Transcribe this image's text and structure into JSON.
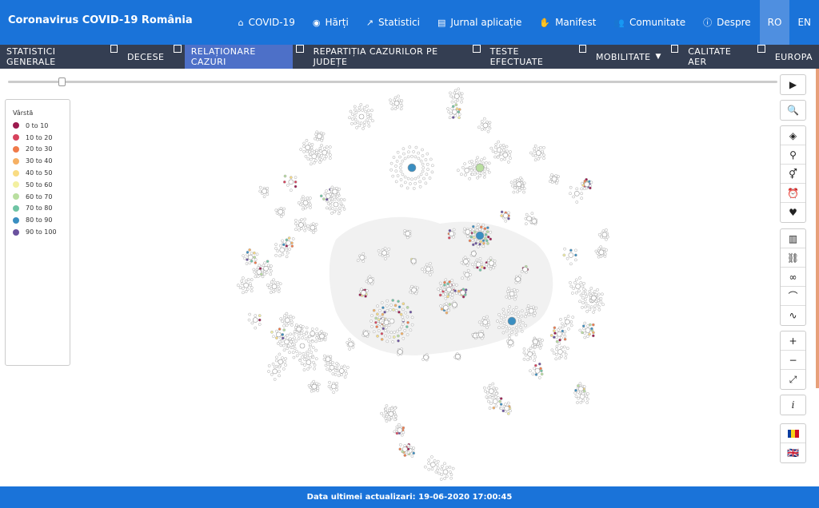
{
  "header": {
    "title": "Coronavirus COVID-19 România",
    "nav": [
      {
        "label": "COVID-19",
        "icon": "home-icon",
        "glyph": "⌂"
      },
      {
        "label": "Hărți",
        "icon": "compass-icon",
        "glyph": "◉"
      },
      {
        "label": "Statistici",
        "icon": "chart-line-icon",
        "glyph": "↗"
      },
      {
        "label": "Jurnal aplicație",
        "icon": "document-icon",
        "glyph": "▤"
      },
      {
        "label": "Manifest",
        "icon": "hand-icon",
        "glyph": "✋"
      },
      {
        "label": "Comunitate",
        "icon": "users-icon",
        "glyph": "👥"
      },
      {
        "label": "Despre",
        "icon": "info-icon",
        "glyph": "ⓘ"
      }
    ],
    "languages": [
      "RO",
      "EN"
    ],
    "active_language": "RO"
  },
  "subnav": {
    "items": [
      {
        "label": "STATISTICI GENERALE",
        "active": false,
        "dropdown": false
      },
      {
        "label": "DECESE",
        "active": false,
        "dropdown": false
      },
      {
        "label": "RELAȚIONARE CAZURI",
        "active": true,
        "dropdown": false
      },
      {
        "label": "REPARTIȚIA CAZURILOR PE JUDEȚE",
        "active": false,
        "dropdown": false
      },
      {
        "label": "TESTE EFECTUATE",
        "active": false,
        "dropdown": false
      },
      {
        "label": "MOBILITATE",
        "active": false,
        "dropdown": true
      },
      {
        "label": "CALITATE AER",
        "active": false,
        "dropdown": false
      },
      {
        "label": "EUROPA",
        "active": false,
        "dropdown": false
      }
    ]
  },
  "timeline": {
    "position": 0.07
  },
  "legend": {
    "title": "Vârstă",
    "items": [
      {
        "label": "0 to 10",
        "color": "#9c1a4e"
      },
      {
        "label": "10 to 20",
        "color": "#d7435d"
      },
      {
        "label": "20 to 30",
        "color": "#f07a4a"
      },
      {
        "label": "30 to 40",
        "color": "#f6b063"
      },
      {
        "label": "40 to 50",
        "color": "#f9dc83"
      },
      {
        "label": "50 to 60",
        "color": "#f3f0a0"
      },
      {
        "label": "60 to 70",
        "color": "#b9dfa0"
      },
      {
        "label": "70 to 80",
        "color": "#6fc4a4"
      },
      {
        "label": "80 to 90",
        "color": "#3a8ec1"
      },
      {
        "label": "90 to 100",
        "color": "#6a519e"
      }
    ]
  },
  "toolbar": {
    "groups": [
      [
        {
          "icon": "play-icon",
          "glyph": "▶"
        }
      ],
      [
        {
          "icon": "search-icon",
          "glyph": "🔍"
        }
      ],
      [
        {
          "icon": "layers-icon",
          "glyph": "◈"
        },
        {
          "icon": "location-pin-icon",
          "glyph": "⚲"
        },
        {
          "icon": "gender-icon",
          "glyph": "⚥"
        },
        {
          "icon": "alarm-clock-icon",
          "glyph": "⏰"
        },
        {
          "icon": "heart-icon",
          "glyph": "♥"
        }
      ],
      [
        {
          "icon": "map-icon",
          "glyph": "▥"
        },
        {
          "icon": "map-links-icon",
          "glyph": "⛓"
        },
        {
          "icon": "links-icon",
          "glyph": "∞"
        },
        {
          "icon": "arc-icon",
          "glyph": "⌒"
        },
        {
          "icon": "path-icon",
          "glyph": "∿"
        }
      ],
      [
        {
          "icon": "zoom-in-icon",
          "glyph": "+"
        },
        {
          "icon": "zoom-out-icon",
          "glyph": "−"
        },
        {
          "icon": "fit-screen-icon",
          "glyph": "⤢"
        }
      ],
      [
        {
          "icon": "info-icon",
          "glyph": "i"
        }
      ],
      [
        {
          "icon": "flag-romania-icon",
          "glyph": ""
        },
        {
          "icon": "flag-uk-icon",
          "glyph": "🇬🇧"
        }
      ]
    ]
  },
  "footer": {
    "last_update": "Data ultimei actualizari: 19-06-2020 17:00:45"
  }
}
